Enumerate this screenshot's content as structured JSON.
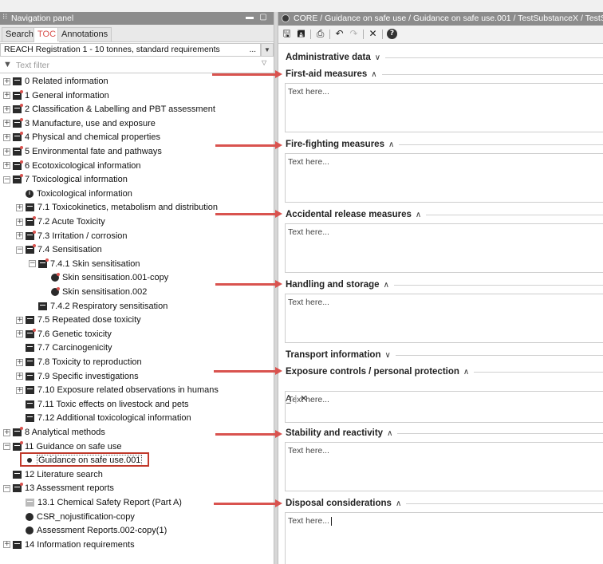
{
  "nav_panel": {
    "title": "Navigation panel",
    "tabs": [
      "Search",
      "TOC",
      "Annotations"
    ],
    "active_tab": "TOC",
    "template_select": "REACH Registration 1 - 10 tonnes, standard requirements",
    "template_more": "...",
    "filter_placeholder": "Text filter",
    "tree": [
      {
        "label": "0 Related information",
        "icon": "doc-icon",
        "expander": "+"
      },
      {
        "label": "1 General information",
        "icon": "doc-flagged-icon",
        "expander": "+"
      },
      {
        "label": "2 Classification & Labelling and PBT assessment",
        "icon": "doc-flagged-icon",
        "expander": "+"
      },
      {
        "label": "3 Manufacture, use and exposure",
        "icon": "doc-flagged-icon",
        "expander": "+"
      },
      {
        "label": "4 Physical and chemical properties",
        "icon": "doc-flagged-icon",
        "expander": "+"
      },
      {
        "label": "5 Environmental fate and pathways",
        "icon": "doc-flagged-icon",
        "expander": "+"
      },
      {
        "label": "6 Ecotoxicological information",
        "icon": "doc-flagged-icon",
        "expander": "+"
      },
      {
        "label": "7 Toxicological information",
        "icon": "doc-flagged-icon",
        "expander": "−"
      },
      {
        "label": "Toxicological information",
        "icon": "info-circle-icon",
        "expander": ""
      },
      {
        "label": "7.1 Toxicokinetics, metabolism and distribution",
        "icon": "doc-icon",
        "expander": "+"
      },
      {
        "label": "7.2 Acute Toxicity",
        "icon": "doc-flagged-icon",
        "expander": "+"
      },
      {
        "label": "7.3 Irritation / corrosion",
        "icon": "doc-flagged-icon",
        "expander": "+"
      },
      {
        "label": "7.4 Sensitisation",
        "icon": "doc-flagged-icon",
        "expander": "−"
      },
      {
        "label": "7.4.1 Skin sensitisation",
        "icon": "doc-flagged-icon",
        "expander": "−"
      },
      {
        "label": "Skin sensitisation.001-copy",
        "icon": "record-flagged-icon",
        "expander": ""
      },
      {
        "label": "Skin sensitisation.002",
        "icon": "record-flagged-icon",
        "expander": ""
      },
      {
        "label": "7.4.2 Respiratory sensitisation",
        "icon": "doc-icon",
        "expander": ""
      },
      {
        "label": "7.5 Repeated dose toxicity",
        "icon": "doc-icon",
        "expander": "+"
      },
      {
        "label": "7.6 Genetic toxicity",
        "icon": "doc-flagged-icon",
        "expander": "+"
      },
      {
        "label": "7.7 Carcinogenicity",
        "icon": "doc-icon",
        "expander": ""
      },
      {
        "label": "7.8 Toxicity to reproduction",
        "icon": "doc-icon",
        "expander": "+"
      },
      {
        "label": "7.9 Specific investigations",
        "icon": "doc-icon",
        "expander": "+"
      },
      {
        "label": "7.10 Exposure related observations in humans",
        "icon": "doc-icon",
        "expander": "+"
      },
      {
        "label": "7.11 Toxic effects on livestock and pets",
        "icon": "doc-icon",
        "expander": ""
      },
      {
        "label": "7.12 Additional toxicological information",
        "icon": "doc-icon",
        "expander": ""
      },
      {
        "label": "8 Analytical methods",
        "icon": "doc-flagged-icon",
        "expander": "+"
      },
      {
        "label": "11 Guidance on safe use",
        "icon": "doc-flagged-icon",
        "expander": "−"
      },
      {
        "label": "Guidance on safe use.001",
        "icon": "record-dot-icon",
        "expander": ""
      },
      {
        "label": "12 Literature search",
        "icon": "doc-icon",
        "expander": ""
      },
      {
        "label": "13 Assessment reports",
        "icon": "doc-flagged-icon",
        "expander": "−"
      },
      {
        "label": "13.1 Chemical Safety Report (Part A)",
        "icon": "doc-grey-icon",
        "expander": ""
      },
      {
        "label": "CSR_nojustification-copy",
        "icon": "record-icon",
        "expander": ""
      },
      {
        "label": "Assessment Reports.002-copy(1)",
        "icon": "record-icon",
        "expander": ""
      },
      {
        "label": "14 Information requirements",
        "icon": "doc-icon",
        "expander": "+"
      }
    ]
  },
  "editor": {
    "title": "CORE / Guidance on safe use / Guidance on safe use.001 / TestSubstanceX / TestS",
    "placeholder": "Text here...",
    "sections": [
      {
        "title": "Administrative data",
        "chevron": "∨",
        "has_text": false
      },
      {
        "title": "First-aid measures",
        "chevron": "∧",
        "has_text": true
      },
      {
        "title": "Fire-fighting measures",
        "chevron": "∧",
        "has_text": true
      },
      {
        "title": "Accidental release measures",
        "chevron": "∧",
        "has_text": true
      },
      {
        "title": "Handling and storage",
        "chevron": "∧",
        "has_text": true
      },
      {
        "title": "Transport information",
        "chevron": "∨",
        "has_text": false
      },
      {
        "title": "Exposure controls / personal protection",
        "chevron": "∧",
        "has_text": true
      },
      {
        "title": "Stability and reactivity",
        "chevron": "∧",
        "has_text": true
      },
      {
        "title": "Disposal considerations",
        "chevron": "∧",
        "has_text": true
      }
    ]
  },
  "colors": {
    "accent": "#d9534f",
    "titlebar": "#8c8c8c",
    "highlight_box": "#c0392b"
  }
}
